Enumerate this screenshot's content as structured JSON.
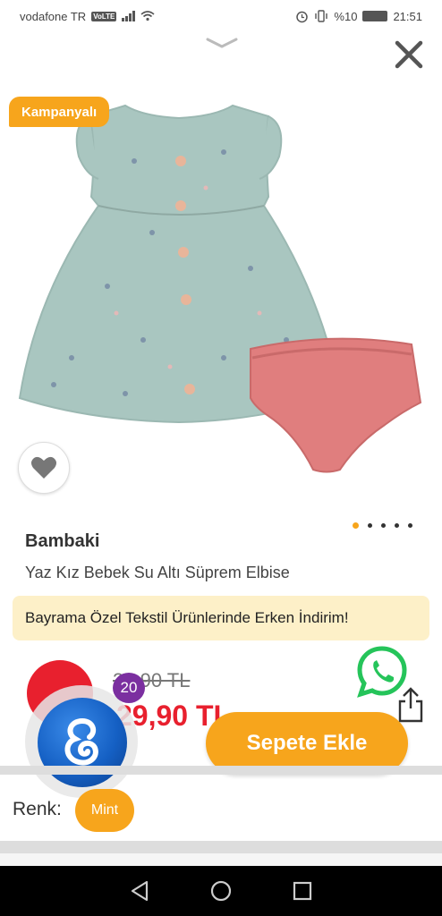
{
  "status_bar": {
    "carrier": "vodafone TR",
    "volte": "VoLTE",
    "battery": "%10",
    "time": "21:51"
  },
  "product": {
    "campaign_badge": "Kampanyalı",
    "brand": "Bambaki",
    "title": "Yaz Kız Bebek Su Altı Süprem Elbise",
    "promo": "Bayrama Özel Tekstil Ürünlerinde Erken İndirim!",
    "old_price": "39,90 TL",
    "new_price": "29,90 TL",
    "image_count": 5,
    "active_image_index": 0
  },
  "assistant": {
    "badge_count": "20"
  },
  "actions": {
    "add_to_cart": "Sepete Ekle"
  },
  "color": {
    "label": "Renk:",
    "selected": "Mint"
  },
  "colors": {
    "accent": "#f7a51c",
    "price_red": "#e8202e",
    "promo_bg": "#fdf0c8",
    "dress": "#a9c6c0",
    "bloomers": "#e07e7e",
    "whatsapp": "#25c45a",
    "assistant_blue": "#1560c4",
    "badge_purple": "#7b2fa0"
  }
}
